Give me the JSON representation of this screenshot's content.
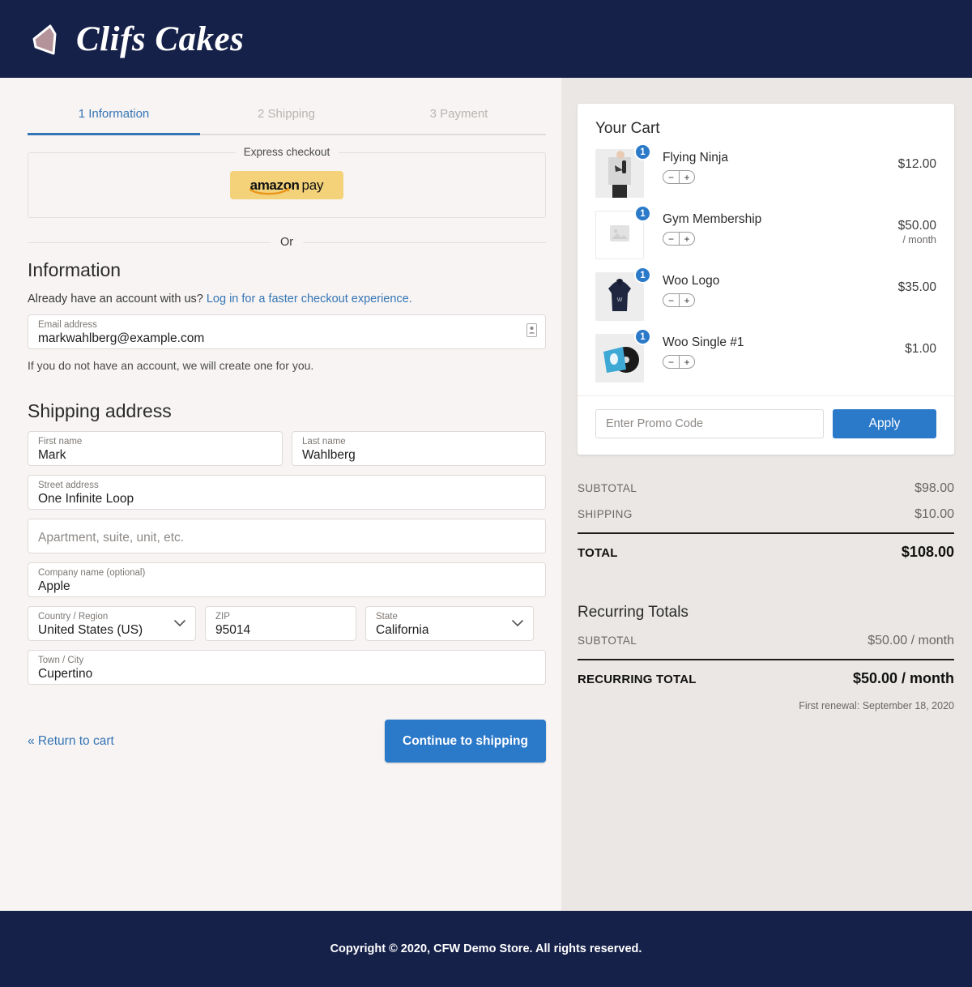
{
  "header": {
    "brand_name": "Clifs Cakes",
    "background_color": "#16214A",
    "logo_shape_color": "#B4949A"
  },
  "steps": [
    {
      "label": "1 Information",
      "active": true
    },
    {
      "label": "2 Shipping",
      "active": false
    },
    {
      "label": "3 Payment",
      "active": false
    }
  ],
  "express": {
    "legend": "Express checkout",
    "amazon_pay": {
      "word_one": "amazon",
      "word_two": "pay",
      "background_color": "#F3D27A"
    },
    "or_label": "Or"
  },
  "information": {
    "title": "Information",
    "account_prompt": "Already have an account with us?",
    "login_link": "Log in for a faster checkout experience.",
    "email": {
      "label": "Email address",
      "value": "markwahlberg@example.com"
    },
    "create_account_note": "If you do not have an account, we will create one for you."
  },
  "shipping": {
    "title": "Shipping address",
    "first_name": {
      "label": "First name",
      "value": "Mark"
    },
    "last_name": {
      "label": "Last name",
      "value": "Wahlberg"
    },
    "street": {
      "label": "Street address",
      "value": "One Infinite Loop"
    },
    "apartment": {
      "label": "",
      "placeholder": "Apartment, suite, unit, etc.",
      "value": ""
    },
    "company": {
      "label": "Company name (optional)",
      "value": "Apple"
    },
    "country": {
      "label": "Country / Region",
      "value": "United States (US)"
    },
    "zip": {
      "label": "ZIP",
      "value": "95014"
    },
    "state": {
      "label": "State",
      "value": "California"
    },
    "city": {
      "label": "Town / City",
      "value": "Cupertino"
    }
  },
  "actions": {
    "return_to_cart": "« Return to cart",
    "continue": "Continue to shipping",
    "primary_color": "#2B79C9"
  },
  "cart": {
    "title": "Your Cart",
    "items": [
      {
        "name": "Flying Ninja",
        "qty": "1",
        "price": "$12.00",
        "price_sub": "",
        "thumb": "poster-photo",
        "minus": "−",
        "plus": "+"
      },
      {
        "name": "Gym Membership",
        "qty": "1",
        "price": "$50.00",
        "price_sub": "/ month",
        "thumb": "image-placeholder",
        "minus": "−",
        "plus": "+"
      },
      {
        "name": "Woo Logo",
        "qty": "1",
        "price": "$35.00",
        "price_sub": "",
        "thumb": "hoodie-photo",
        "minus": "−",
        "plus": "+"
      },
      {
        "name": "Woo Single #1",
        "qty": "1",
        "price": "$1.00",
        "price_sub": "",
        "thumb": "vinyl-record-photo",
        "minus": "−",
        "plus": "+"
      }
    ],
    "promo": {
      "placeholder": "Enter Promo Code",
      "value": "",
      "apply_label": "Apply"
    }
  },
  "totals": {
    "rows": [
      {
        "label": "SUBTOTAL",
        "value": "$98.00"
      },
      {
        "label": "SHIPPING",
        "value": "$10.00"
      }
    ],
    "grand": {
      "label": "TOTAL",
      "value": "$108.00"
    }
  },
  "recurring": {
    "title": "Recurring Totals",
    "rows": [
      {
        "label": "SUBTOTAL",
        "value": "$50.00 / month"
      }
    ],
    "grand": {
      "label": "RECURRING TOTAL",
      "value": "$50.00 / month"
    },
    "renewal_note": "First renewal: September 18, 2020"
  },
  "footer": {
    "copyright": "Copyright © 2020, CFW Demo Store. All rights reserved."
  }
}
